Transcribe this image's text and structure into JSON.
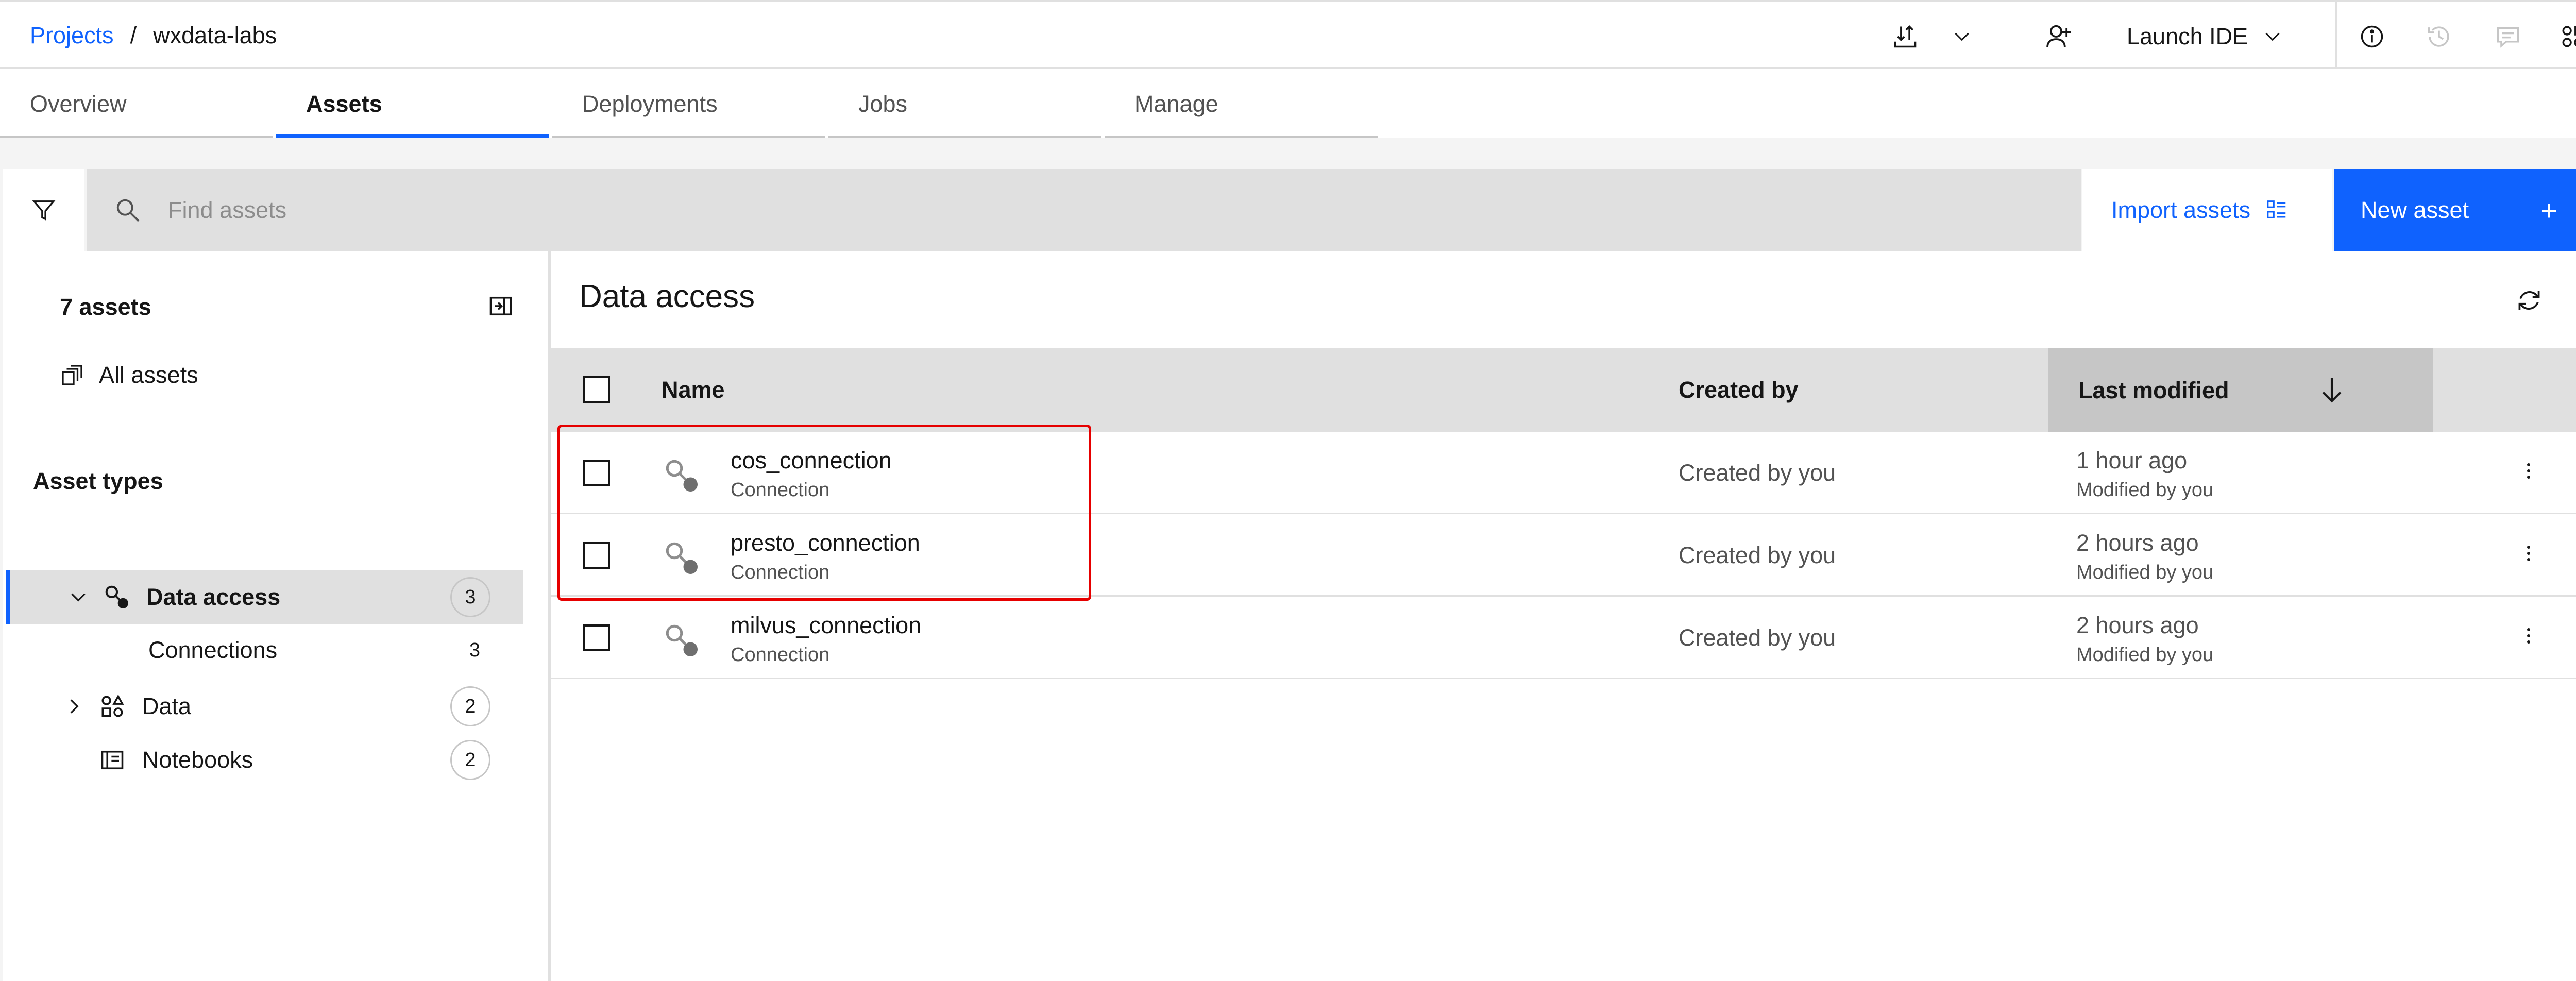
{
  "breadcrumb": {
    "parent": "Projects",
    "separator": "/",
    "current": "wxdata-labs"
  },
  "header": {
    "launch_ide_label": "Launch IDE"
  },
  "tabs": [
    {
      "label": "Overview"
    },
    {
      "label": "Assets"
    },
    {
      "label": "Deployments"
    },
    {
      "label": "Jobs"
    },
    {
      "label": "Manage"
    }
  ],
  "active_tab": "Assets",
  "toolbar": {
    "search_placeholder": "Find assets",
    "import_label": "Import assets",
    "new_asset_label": "New asset",
    "new_asset_icon": "+"
  },
  "sidebar": {
    "asset_count": "7 assets",
    "all_assets_label": "All assets",
    "asset_types_title": "Asset types",
    "types": [
      {
        "label": "Data access",
        "count": "3",
        "expanded": true,
        "selected": true
      },
      {
        "label": "Connections",
        "count": "3",
        "sub": true
      },
      {
        "label": "Data",
        "count": "2",
        "expanded": false
      },
      {
        "label": "Notebooks",
        "count": "2"
      }
    ]
  },
  "main": {
    "title": "Data access",
    "columns": {
      "name": "Name",
      "created_by": "Created by",
      "last_modified": "Last modified"
    },
    "rows": [
      {
        "name": "cos_connection",
        "type": "Connection",
        "created_by": "Created by you",
        "modified": "1 hour ago",
        "modified_by": "Modified by you"
      },
      {
        "name": "presto_connection",
        "type": "Connection",
        "created_by": "Created by you",
        "modified": "2 hours ago",
        "modified_by": "Modified by you"
      },
      {
        "name": "milvus_connection",
        "type": "Connection",
        "created_by": "Created by you",
        "modified": "2 hours ago",
        "modified_by": "Modified by you"
      }
    ]
  },
  "colors": {
    "accent": "#0f62fe",
    "highlight": "#e60000"
  }
}
